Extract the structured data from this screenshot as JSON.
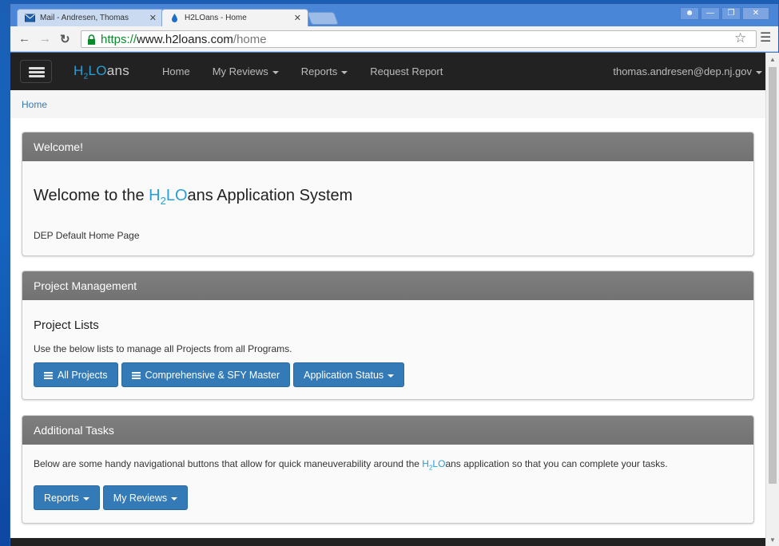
{
  "browser": {
    "tabs": [
      {
        "label": "Mail - Andresen, Thomas",
        "active": false,
        "icon": "mail-icon"
      },
      {
        "label": "H2LOans - Home",
        "active": true,
        "icon": "h2loans-drop-icon"
      }
    ],
    "url_scheme": "https://",
    "url_host": "www.h2loans.com",
    "url_path": "/home",
    "window_controls": [
      "user-icon",
      "minimize-icon",
      "restore-icon",
      "close-icon"
    ]
  },
  "navbar": {
    "brand_h": "H",
    "brand_sub": "2",
    "brand_lo": "LO",
    "brand_rest": "ans",
    "links": [
      {
        "label": "Home",
        "dropdown": false
      },
      {
        "label": "My Reviews",
        "dropdown": true
      },
      {
        "label": "Reports",
        "dropdown": true
      },
      {
        "label": "Request Report",
        "dropdown": false
      }
    ],
    "user": "thomas.andresen@dep.nj.gov"
  },
  "breadcrumb": "Home",
  "welcome": {
    "heading": "Welcome!",
    "title_prefix": "Welcome to the ",
    "title_h": "H",
    "title_sub": "2",
    "title_lo": "LO",
    "title_suffix": "ans Application System",
    "subtitle": "DEP Default Home Page"
  },
  "project_management": {
    "heading": "Project Management",
    "section_title": "Project Lists",
    "description": "Use the below lists to manage all Projects from all Programs.",
    "buttons": [
      {
        "label": "All Projects",
        "icon": "list-icon",
        "dropdown": false
      },
      {
        "label": "Comprehensive & SFY Master",
        "icon": "list-icon",
        "dropdown": false
      },
      {
        "label": "Application Status",
        "icon": "",
        "dropdown": true
      }
    ]
  },
  "additional_tasks": {
    "heading": "Additional Tasks",
    "description_prefix": "Below are some handy navigational buttons that allow for quick maneuverability around the ",
    "description_h": "H",
    "description_sub": "2",
    "description_lo": "LO",
    "description_suffix": "ans application so that you can complete your tasks.",
    "buttons": [
      {
        "label": "Reports",
        "dropdown": true
      },
      {
        "label": "My Reviews",
        "dropdown": true
      }
    ]
  },
  "colors": {
    "primary": "#337ab7",
    "brand_blue": "#2a9fd6",
    "navbar": "#222222",
    "panel_header": "#7a7a7a"
  }
}
